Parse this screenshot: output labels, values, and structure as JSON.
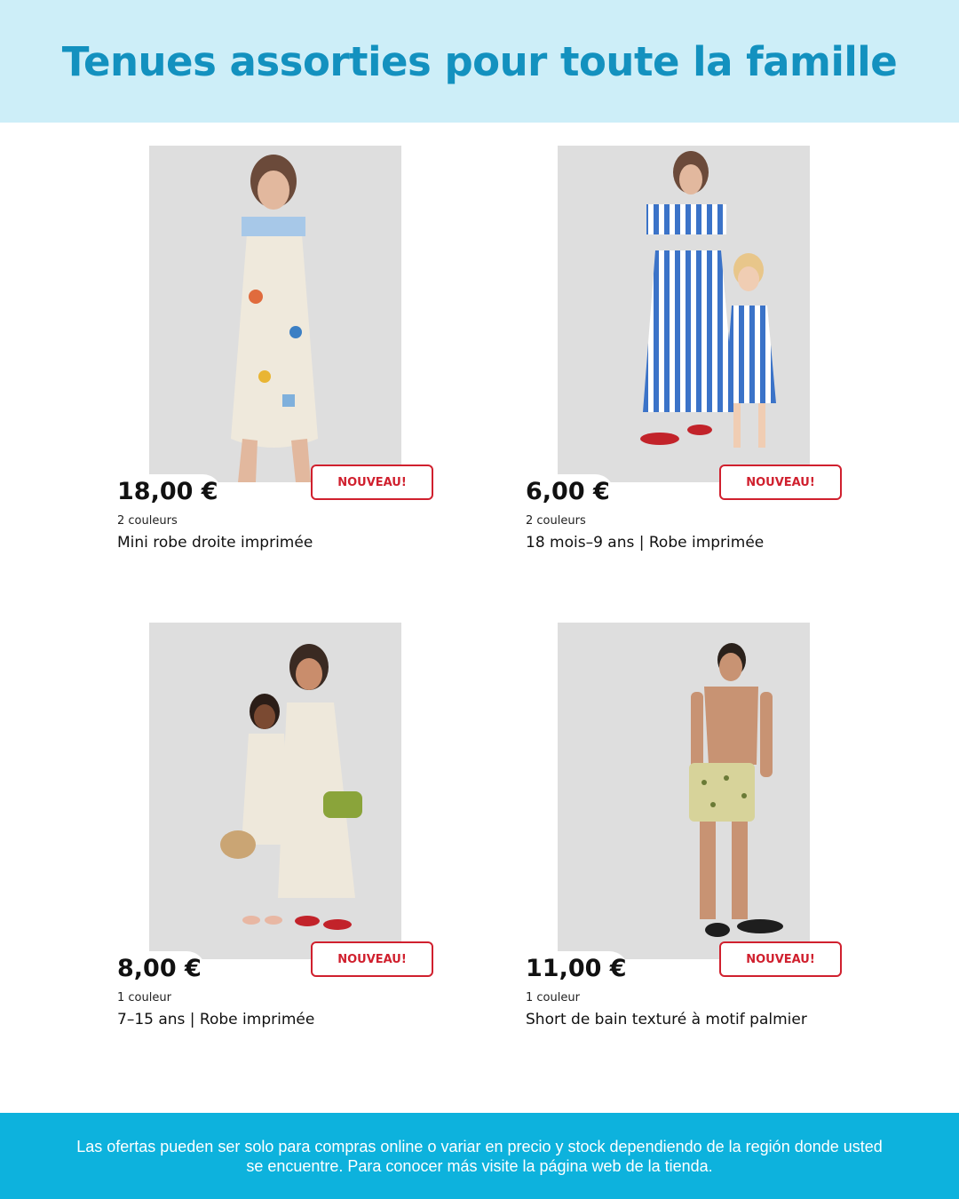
{
  "header": {
    "title": "Tenues assorties pour toute la famille"
  },
  "products": [
    {
      "price": "18,00 €",
      "badge": "NOUVEAU!",
      "colors": "2 couleurs",
      "name": "Mini robe droite imprimée"
    },
    {
      "price": "6,00 €",
      "badge": "NOUVEAU!",
      "colors": "2 couleurs",
      "name": "18 mois–9 ans | Robe imprimée"
    },
    {
      "price": "8,00 €",
      "badge": "NOUVEAU!",
      "colors": "1 couleur",
      "name": "7–15 ans | Robe imprimée"
    },
    {
      "price": "11,00 €",
      "badge": "NOUVEAU!",
      "colors": "1 couleur",
      "name": "Short de bain texturé à motif palmier"
    }
  ],
  "footer": {
    "disclaimer": "Las ofertas pueden ser solo para compras online o variar en precio y stock dependiendo de la región donde usted se encuentre. Para conocer más visite la página web de la tienda."
  },
  "colors": {
    "header_bg": "#cdeef8",
    "title": "#1391bf",
    "badge": "#d0202e",
    "footer_bg": "#0db2dd"
  }
}
